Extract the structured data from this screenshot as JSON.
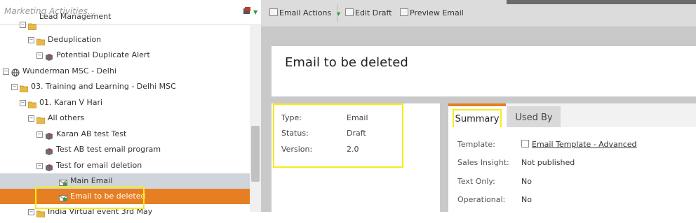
{
  "search": {
    "placeholder": "Marketing Activities..."
  },
  "tree": [
    {
      "label": "Lead Management",
      "indent": 28,
      "icon": "folder-icon",
      "partial": true
    },
    {
      "label": "Deduplication",
      "indent": 40,
      "icon": "folder-icon"
    },
    {
      "label": "Potential Duplicate Alert",
      "indent": 52,
      "icon": "program-icon"
    },
    {
      "label": "Wunderman MSC - Delhi",
      "indent": 4,
      "icon": "globe-icon"
    },
    {
      "label": "03. Training and Learning - Delhi MSC",
      "indent": 16,
      "icon": "folder-icon"
    },
    {
      "label": "01. Karan V Hari",
      "indent": 28,
      "icon": "folder-icon"
    },
    {
      "label": "All others",
      "indent": 40,
      "icon": "folder-icon"
    },
    {
      "label": "Karan AB test Test",
      "indent": 52,
      "icon": "program-icon"
    },
    {
      "label": "Test AB test email program",
      "indent": 52,
      "icon": "program-icon",
      "noexp": true
    },
    {
      "label": "Test for email deletion",
      "indent": 52,
      "icon": "program-icon"
    },
    {
      "label": "Main Email",
      "indent": 72,
      "icon": "email-icon",
      "hl": true
    },
    {
      "label": "Email to be deleted",
      "indent": 72,
      "icon": "email-icon",
      "sel": true
    },
    {
      "label": "India Virtual event 3rd May",
      "indent": 40,
      "icon": "folder-icon",
      "partial": true
    }
  ],
  "toolbar": {
    "email_actions": "Email Actions",
    "edit_draft": "Edit Draft",
    "preview_email": "Preview Email"
  },
  "asset": {
    "title": "Email to be deleted"
  },
  "properties": [
    {
      "key": "Type:",
      "value": "Email"
    },
    {
      "key": "Status:",
      "value": "Draft"
    },
    {
      "key": "Version:",
      "value": "2.0"
    }
  ],
  "tabs": [
    {
      "label": "Summary",
      "active": true
    },
    {
      "label": "Used By",
      "active": false
    }
  ],
  "summary": [
    {
      "key": "Template:",
      "value": "Email Template - Advanced",
      "link": true
    },
    {
      "key": "Sales Insight:",
      "value": "Not published"
    },
    {
      "key": "Text Only:",
      "value": "No"
    },
    {
      "key": "Operational:",
      "value": "No"
    }
  ],
  "colors": {
    "accent": "#e67e22",
    "highlight_box": "#f5ec17"
  }
}
